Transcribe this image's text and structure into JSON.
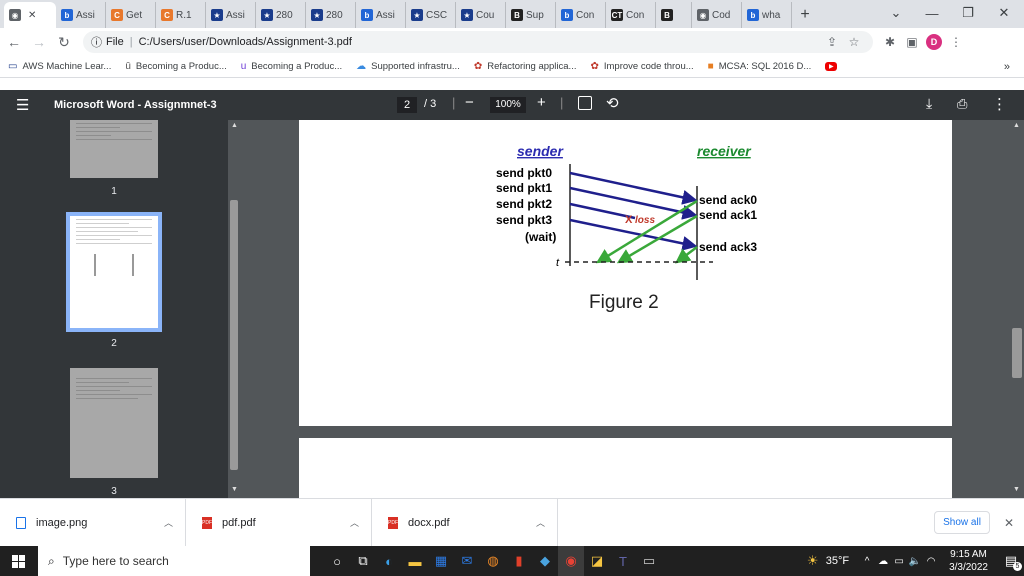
{
  "browser": {
    "tabs": [
      {
        "label": "",
        "icon": "chrome-icon",
        "color": "#5f6368",
        "glyph": "◉"
      },
      {
        "label": "Assi",
        "icon": "bing-icon",
        "color": "#2266d6",
        "glyph": "b"
      },
      {
        "label": "Get",
        "icon": "chegg-c-icon",
        "color": "#e8782c",
        "glyph": "C"
      },
      {
        "label": "R.1",
        "icon": "chegg-c-icon",
        "color": "#e8782c",
        "glyph": "C"
      },
      {
        "label": "Assi",
        "icon": "star-box-icon",
        "color": "#1a3c8c",
        "glyph": "★"
      },
      {
        "label": "280",
        "icon": "star-box-icon",
        "color": "#1a3c8c",
        "glyph": "★"
      },
      {
        "label": "280",
        "icon": "star-box-icon",
        "color": "#1a3c8c",
        "glyph": "★"
      },
      {
        "label": "Assi",
        "icon": "bing-icon",
        "color": "#2266d6",
        "glyph": "b"
      },
      {
        "label": "CSC",
        "icon": "star-box-icon",
        "color": "#1a3c8c",
        "glyph": "★"
      },
      {
        "label": "Cou",
        "icon": "star-box-icon",
        "color": "#1a3c8c",
        "glyph": "★"
      },
      {
        "label": "Sup",
        "icon": "b-box-icon",
        "color": "#222222",
        "glyph": "B"
      },
      {
        "label": "Con",
        "icon": "bing-icon",
        "color": "#2266d6",
        "glyph": "b"
      },
      {
        "label": "Con",
        "icon": "ct-icon",
        "color": "#222222",
        "glyph": "CT"
      },
      {
        "label": "",
        "icon": "b-box-icon",
        "color": "#222222",
        "glyph": "B"
      },
      {
        "label": "Cod",
        "icon": "chrome-icon",
        "color": "#5f6368",
        "glyph": "◉"
      },
      {
        "label": "wha",
        "icon": "bing-icon",
        "color": "#2266d6",
        "glyph": "b"
      }
    ],
    "window_controls": {
      "chevron": "⌄",
      "minimize": "—",
      "restore": "❐",
      "close": "✕"
    },
    "address": {
      "prefix": "File",
      "url": "C:/Users/user/Downloads/Assignment-3.pdf"
    },
    "profile_initial": "D",
    "bookmarks": [
      {
        "label": "AWS Machine Lear...",
        "color": "#1f3d8a",
        "glyph": "▭"
      },
      {
        "label": "Becoming a Produc...",
        "color": "#555555",
        "glyph": "ū"
      },
      {
        "label": "Becoming a Produc...",
        "color": "#6c3bd6",
        "glyph": "u"
      },
      {
        "label": "Supported infrastru...",
        "color": "#3a8be0",
        "glyph": "☁"
      },
      {
        "label": "Refactoring applica...",
        "color": "#c0392b",
        "glyph": "✿"
      },
      {
        "label": "Improve code throu...",
        "color": "#c0392b",
        "glyph": "✿"
      },
      {
        "label": "MCSA: SQL 2016 D...",
        "color": "#e67e22",
        "glyph": "■"
      }
    ],
    "bookmarks_more": "»"
  },
  "pdf": {
    "title": "Microsoft Word - Assignmnet-3",
    "current_page": "2",
    "total_pages": "/ 3",
    "zoom": "100%",
    "thumbnails": [
      "1",
      "2",
      "3"
    ]
  },
  "figure": {
    "sender": "sender",
    "receiver": "receiver",
    "sends": [
      "send pkt0",
      "send pkt1",
      "send pkt2",
      "send pkt3"
    ],
    "wait": "(wait)",
    "acks": [
      "send ack0",
      "send ack1",
      "send ack3"
    ],
    "loss": "loss",
    "loss_mark": "X",
    "t": "t",
    "caption": "Figure 2"
  },
  "downloads": {
    "items": [
      {
        "label": "image.png",
        "icon": "image-file-icon"
      },
      {
        "label": "pdf.pdf",
        "icon": "pdf-file-icon"
      },
      {
        "label": "docx.pdf",
        "icon": "pdf-file-icon"
      }
    ],
    "show_all": "Show all"
  },
  "taskbar": {
    "search_placeholder": "Type here to search",
    "temperature": "35°F",
    "time": "9:15 AM",
    "date": "3/3/2022",
    "notification_count": "5"
  },
  "colors": {
    "sender": "#2b2bb0",
    "receiver": "#1b8a2f",
    "pkt_arrow": "#1f1f8c",
    "ack_arrow": "#3aa83a",
    "loss": "#c0392b"
  }
}
